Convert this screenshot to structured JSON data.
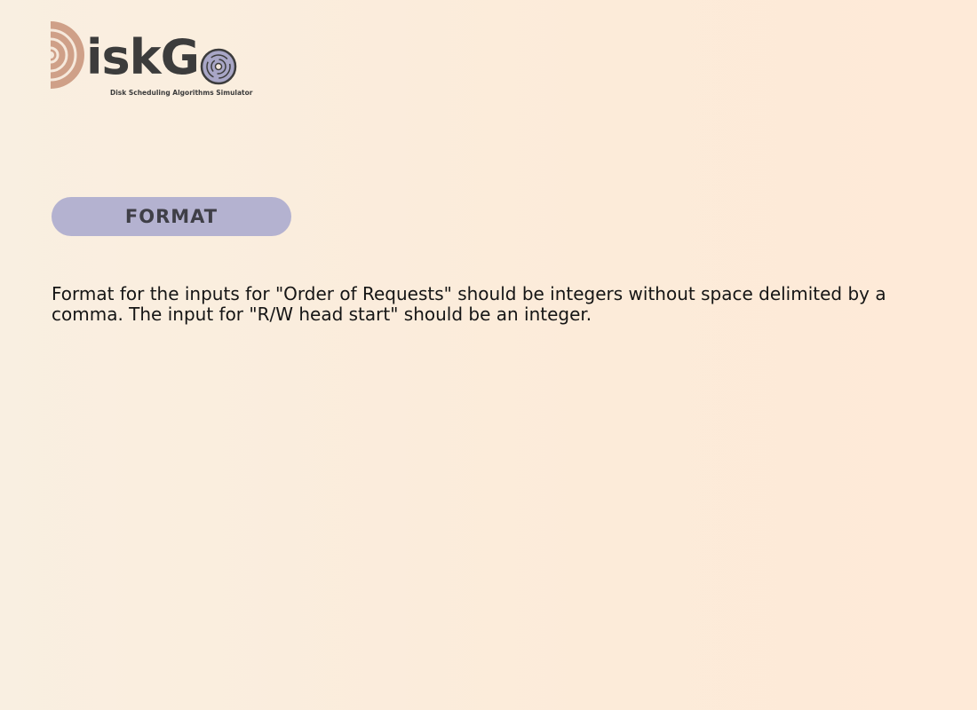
{
  "logo": {
    "word": "iskG",
    "subtitle": "Disk Scheduling Algorithms Simulator",
    "colors": {
      "d_arc": "#cfa088",
      "o_disk": "#a8a6c6",
      "text": "#3c3c3c"
    }
  },
  "section": {
    "title": "FORMAT",
    "pill_color": "#b4b2d0"
  },
  "content": {
    "description": "Format for the inputs for \"Order of Requests\" should be integers without space delimited by a comma. The input for \"R/W head start\" should be an integer."
  }
}
